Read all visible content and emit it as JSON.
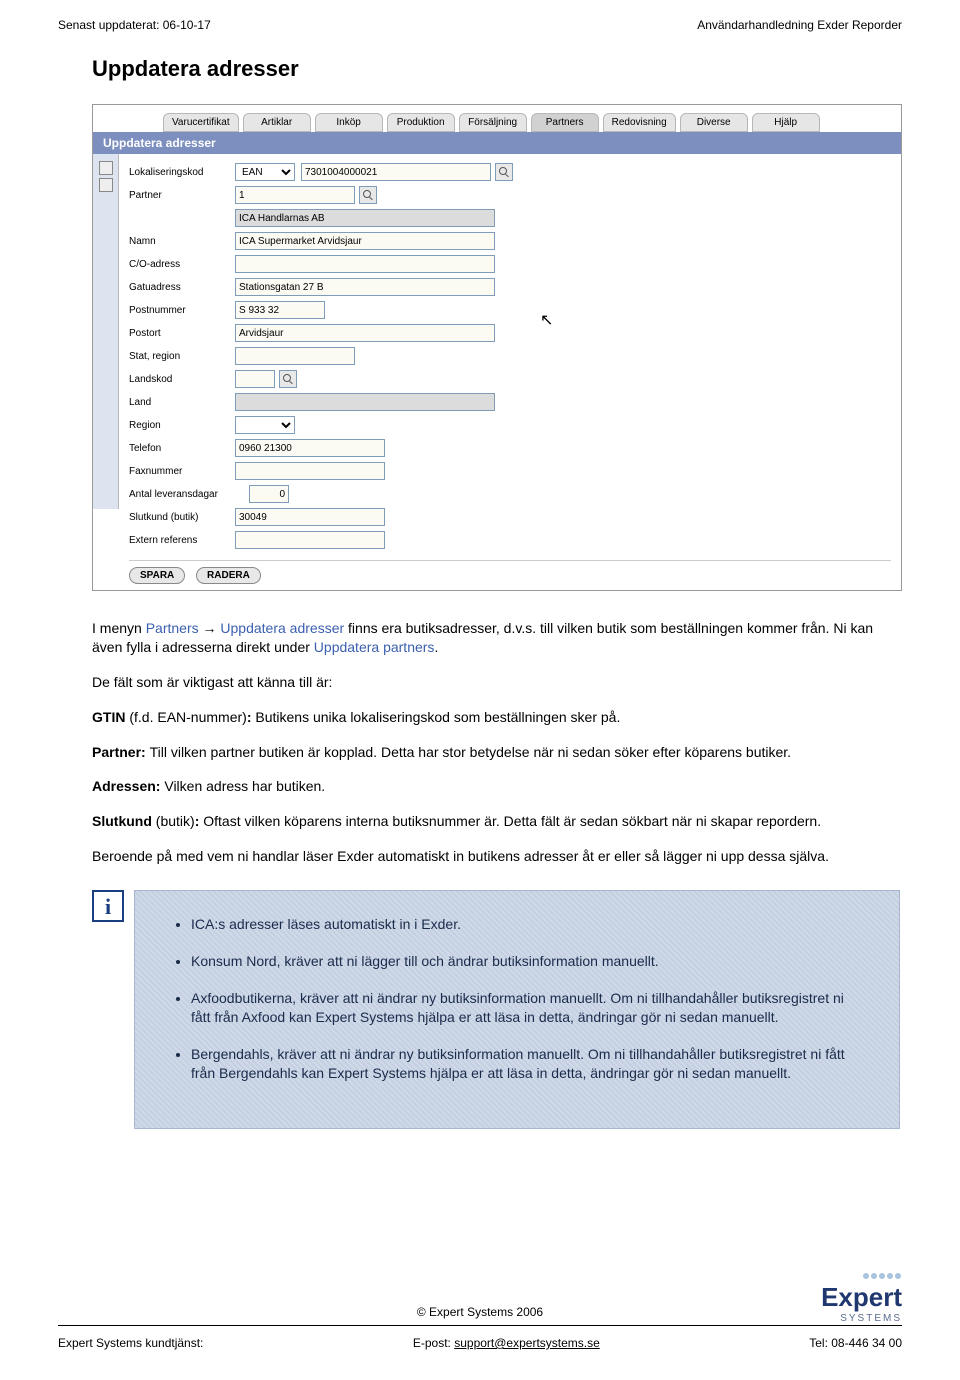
{
  "header": {
    "left": "Senast uppdaterat: 06-10-17",
    "right": "Användarhandledning Exder Reporder"
  },
  "title": "Uppdatera adresser",
  "screenshot": {
    "tabs": [
      "Varucertifikat",
      "Artiklar",
      "Inköp",
      "Produktion",
      "Försäljning",
      "Partners",
      "Redovisning",
      "Diverse",
      "Hjälp"
    ],
    "window_title": "Uppdatera adresser",
    "fields": {
      "lokaliseringskod_label": "Lokaliseringskod",
      "lokaliseringskod_type": "EAN",
      "lokaliseringskod_value": "7301004000021",
      "partner_label": "Partner",
      "partner_value": "1",
      "partner_name": "ICA Handlarnas AB",
      "namn_label": "Namn",
      "namn_value": "ICA Supermarket Arvidsjaur",
      "co_label": "C/O-adress",
      "co_value": "",
      "gatu_label": "Gatuadress",
      "gatu_value": "Stationsgatan 27 B",
      "postnr_label": "Postnummer",
      "postnr_value": "S 933 32",
      "postort_label": "Postort",
      "postort_value": "Arvidsjaur",
      "stat_label": "Stat, region",
      "stat_value": "",
      "landskod_label": "Landskod",
      "landskod_value": "",
      "land_label": "Land",
      "land_value": "",
      "region_label": "Region",
      "region_value": "",
      "telefon_label": "Telefon",
      "telefon_value": "0960 21300",
      "fax_label": "Faxnummer",
      "fax_value": "",
      "leveransdagar_label": "Antal leveransdagar",
      "leveransdagar_value": "0",
      "slutkund_label": "Slutkund (butik)",
      "slutkund_value": "30049",
      "extern_label": "Extern referens",
      "extern_value": ""
    },
    "buttons": {
      "save": "SPARA",
      "delete": "RADERA"
    }
  },
  "body": {
    "p1_prefix": "I menyn ",
    "p1_link1": "Partners",
    "p1_arrow": " → ",
    "p1_link2": "Uppdatera adresser",
    "p1_rest": " finns era butiksadresser, d.v.s. till vilken butik som beställningen kommer från. Ni kan även fylla i adresserna direkt under ",
    "p1_link3": "Uppdatera partners",
    "p1_end": ".",
    "p2": "De fält som är viktigast att känna till är:",
    "p3_b": "GTIN ",
    "p3_rest": "(f.d. EAN-nummer)",
    "p3_b2": ": ",
    "p3_text": "Butikens unika lokaliseringskod som beställningen sker på.",
    "p4_b": "Partner: ",
    "p4_text": "Till vilken partner butiken är kopplad. Detta har stor betydelse när ni sedan söker efter köparens butiker.",
    "p5_b": "Adressen: ",
    "p5_text": "Vilken adress har butiken.",
    "p6_b": "Slutkund ",
    "p6_mid": "(butik)",
    "p6_b2": ": ",
    "p6_text": "Oftast vilken köparens interna butiksnummer är. Detta fält är sedan sökbart när ni skapar repordern.",
    "p7": "Beroende på med vem ni handlar läser Exder automatiskt in butikens adresser åt er eller så lägger ni upp dessa själva."
  },
  "bluebox": {
    "items": [
      "ICA:s adresser läses automatiskt in i Exder.",
      "Konsum Nord, kräver att ni lägger till och ändrar butiksinformation manuellt.",
      "Axfoodbutikerna, kräver att ni ändrar ny butiksinformation manuellt. Om ni tillhandahåller butiksregistret ni fått från Axfood kan Expert Systems hjälpa er att läsa in detta, ändringar gör ni sedan manuellt.",
      "Bergendahls, kräver att ni ändrar ny butiksinformation manuellt. Om ni tillhandahåller butiksregistret ni fått från Bergendahls kan Expert Systems hjälpa er att läsa in detta, ändringar gör ni sedan manuellt."
    ]
  },
  "footer": {
    "copy": "© Expert Systems 2006",
    "left": "Expert Systems kundtjänst:",
    "mid_label": "E-post: ",
    "mid_link": "support@expertsystems.se",
    "right": "Tel: 08-446 34 00"
  },
  "logo": {
    "name": "Expert",
    "sub": "SYSTEMS"
  }
}
